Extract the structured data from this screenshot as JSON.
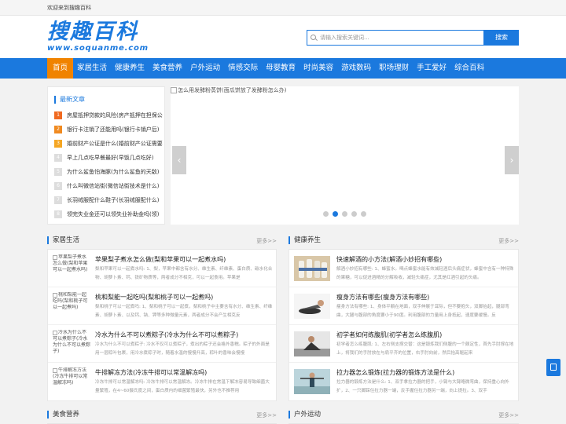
{
  "topbar": {
    "welcome": "欢迎来到搜趣百科"
  },
  "logo": {
    "title": "搜趣百科",
    "url": "www.soquanme.com"
  },
  "search": {
    "placeholder": "请输入搜索关键词...",
    "button": "搜索"
  },
  "nav": [
    "首页",
    "家居生活",
    "健康养生",
    "美食营养",
    "户外运动",
    "情感交际",
    "母婴教育",
    "时尚美容",
    "游戏数码",
    "职场理财",
    "手工爱好",
    "综合百科"
  ],
  "latest": {
    "title": "最新文章",
    "items": [
      "房屋抵押贷款的风险(房产抵押在担保公司)",
      "银行卡注销了还能用吗(银行卡销户后)",
      "婚前财产公证是什么(婚前财产公证需要)",
      "早上几点吃早餐最好(早饭几点吃好)",
      "为什么鲨鱼怕海豚(为什么鲨鱼的天敌)",
      "什么叫微信站街(微信站街技术是什么)",
      "长羽绒服配什么鞋子(长羽绒服配什么)",
      "领完失业金还可以领失业补助金吗(领)"
    ]
  },
  "slider": {
    "image_alt": "怎么用发酵粉蒸饼(面瓜饼放了发酵粉怎么办)",
    "prev": "‹",
    "next": "›",
    "dot_count": 5,
    "active_dot": 2
  },
  "sections": [
    {
      "name": "家居生活",
      "more": "更多>>",
      "articles": [
        {
          "thumb_alt": "苹果梨子煮水怎么做(梨和苹果可以一起煮水吗)",
          "title": "苹果梨子煮水怎么做(梨和苹果可以一起煮水吗)",
          "desc": "梨和苹果可以一起煮水吗: 1、梨，苹果中都含有水分、维生素、纤维素、蛋白质、碳水化合物、胡萝卜素、钙、铁矿物质等，两者成分不相克，可以一起食用。苹果是"
        },
        {
          "thumb_alt": "桃和梨能一起吃吗(梨和桃子可以一起煮吗)",
          "title": "桃和梨能一起吃吗(梨和桃子可以一起煮吗)",
          "desc": "梨和桃子可以一起煮吗: 1、梨和桃子可以一起煮，梨和桃子中主要含有水分、维生素、纤维素、胡萝卜素、以及钙、钠、钾等多种微量元素，两者成分不会产生相克反"
        },
        {
          "thumb_alt": "冷水为什么不可以煮粽子(冷水为什么不可以煮粽子)",
          "title": "冷水为什么不可以煮粽子(冷水为什么不可以煮粽子)",
          "desc": "冷水为什么不可以煮粽子: 冷水不仅可以煮粽子，煮出的粽子还会格外香糯。粽子的外面是用一层粽叶包裹，用冷水煮粽子时，随着水温的慢慢升高，粽叶的香味会慢慢"
        },
        {
          "thumb_alt": "牛排解冻方法(冷冻牛排可以常温解冻吗)",
          "title": "牛排解冻方法(冷冻牛排可以常温解冻吗)",
          "desc": "冷冻牛排可以常温解冻吗: 冷冻牛排可以常温解冻。冷冻牛排在常温下解冻容易导致细菌大量繁殖，在4~60摄氏度之间，蛋白质内的细菌繁殖最快，另外也不推荐用"
        }
      ]
    },
    {
      "name": "健康养生",
      "more": "更多>>",
      "articles": [
        {
          "title": "快速解酒的小方法(解酒小妙招有哪些)",
          "desc": "解酒小妙招有哪些: 1、蜂蜜水。喝点蜂蜜水能有效减轻酒后头痛症状，蜂蜜中含有一种特殊的果糖，可以促进酒精的分解吸收，减轻头痛症，尤其是红酒引起的头痛。"
        },
        {
          "title": "瘦身方法有哪些(瘦身方法有哪些)",
          "desc": "瘦身方法有哪些: 1、身体平躺在地面，双手伸展于耳际，但不要抱头，双脚抬起，腿部弯曲，大腿与腹部的角度要小于90度。利用腹部的力量用上身抵起，速度要缓慢。反"
        },
        {
          "title": "初学者如何练腹肌(初学者怎么练腹肌)",
          "desc": "初学者怎么练腹肌: 1、左右侧支撑交替：这是锻炼我们侧腹的一个颇定性，首先手肘撑在地上，将我们的手肘放在与肩平齐的位置，右手肘向前，然后抬高躯起来"
        },
        {
          "title": "拉力器怎么锻炼(拉力器的锻炼方法是什么)",
          "desc": "拉力器的锻炼方法是什么: 1、双手拿拉力器的把手，小臂与大臂略微弯曲，保持重心向外扩，2、一只脚踩住拉力器一端，反手握住拉力器另一端，向上提拉。3、双手"
        }
      ]
    },
    {
      "name": "美食营养",
      "more": "更多>>"
    },
    {
      "name": "户外运动",
      "more": "更多>>"
    }
  ]
}
